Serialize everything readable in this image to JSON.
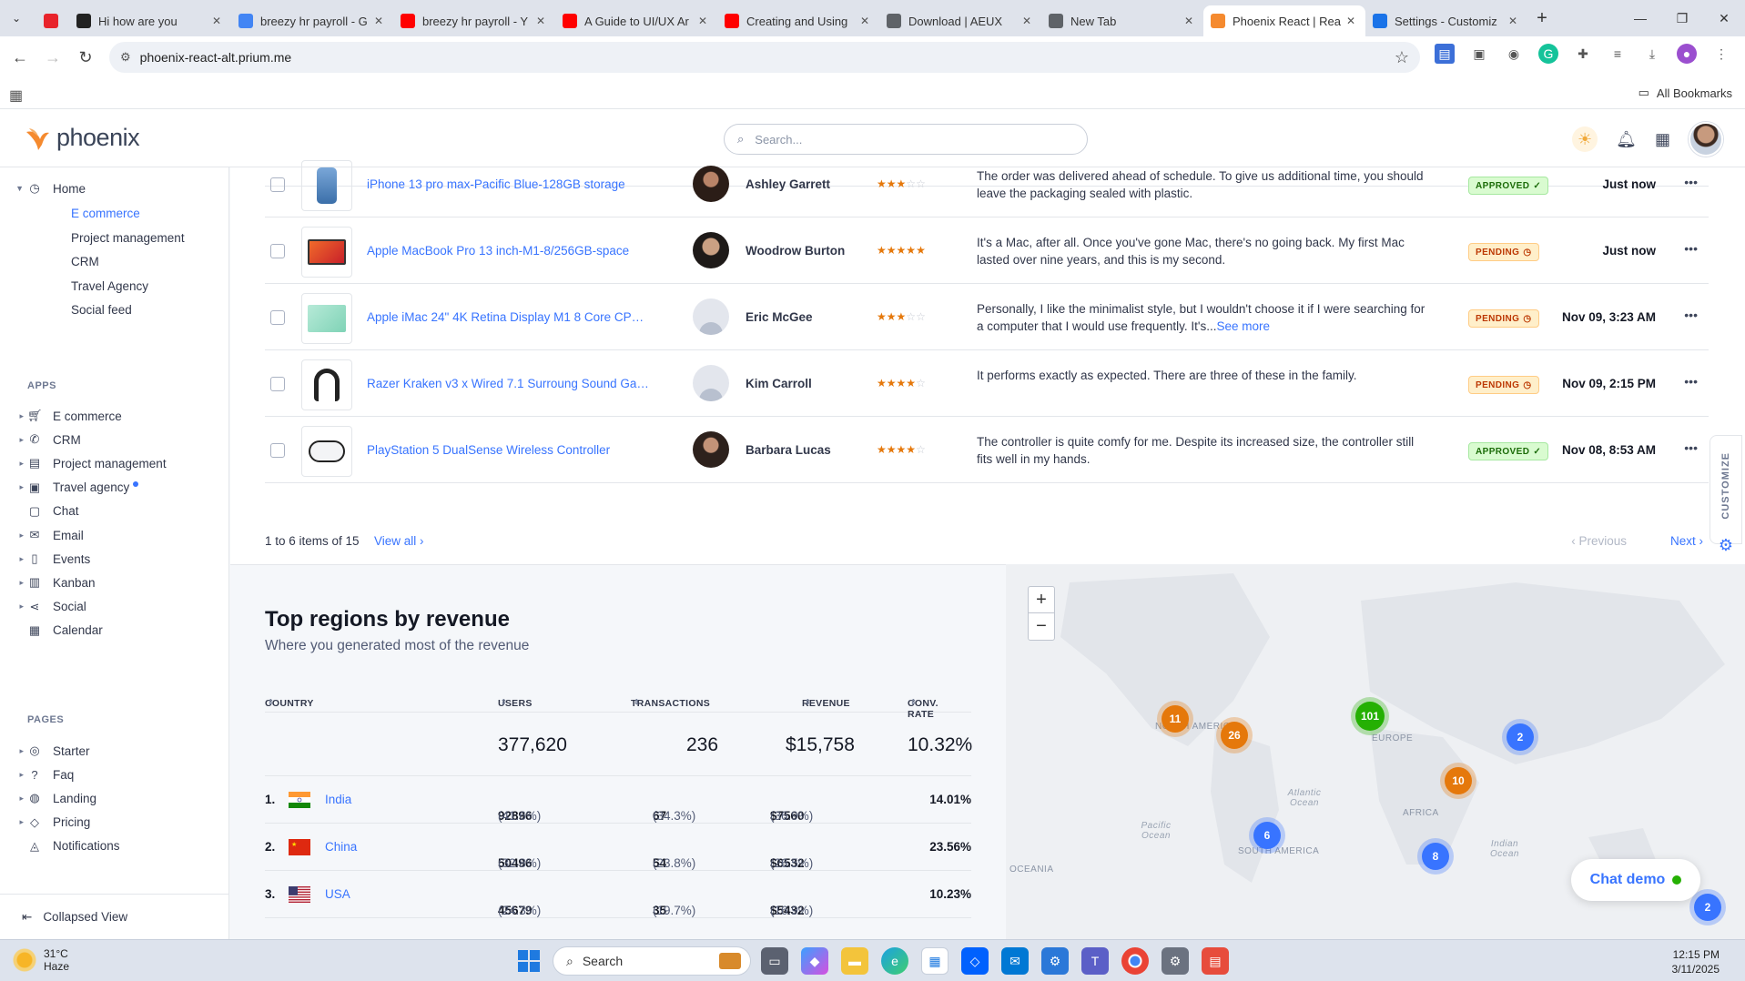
{
  "browser": {
    "tabs": [
      {
        "title": "",
        "color": "#e8232b",
        "pinned": true
      },
      {
        "title": "Hi how are you",
        "color": "#222222"
      },
      {
        "title": "breezy hr payroll - G",
        "color": "#4285f4"
      },
      {
        "title": "breezy hr payroll - Y",
        "color": "#ff0000"
      },
      {
        "title": "A Guide to UI/UX Ar",
        "color": "#ff0000"
      },
      {
        "title": "Creating and Using",
        "color": "#ff0000"
      },
      {
        "title": "Download | AEUX",
        "color": "#5f6368"
      },
      {
        "title": "New Tab",
        "color": "#5f6368"
      },
      {
        "title": "Phoenix React | Rea",
        "color": "#f58a2f",
        "active": true
      },
      {
        "title": "Settings - Customiz",
        "color": "#1a73e8"
      }
    ],
    "url": "phoenix-react-alt.prium.me",
    "all_bookmarks": "All Bookmarks"
  },
  "header": {
    "brand": "phoenix",
    "search_placeholder": "Search..."
  },
  "sidebar": {
    "home": "Home",
    "home_sub": [
      {
        "label": "E commerce",
        "active": true
      },
      {
        "label": "Project management"
      },
      {
        "label": "CRM"
      },
      {
        "label": "Travel Agency"
      },
      {
        "label": "Social feed"
      }
    ],
    "apps_heading": "APPS",
    "apps": [
      {
        "label": "E commerce",
        "icon": "cart-icon"
      },
      {
        "label": "CRM",
        "icon": "phone-icon"
      },
      {
        "label": "Project management",
        "icon": "clipboard-icon"
      },
      {
        "label": "Travel agency",
        "icon": "briefcase-icon"
      },
      {
        "label": "Chat",
        "icon": "chat-icon"
      },
      {
        "label": "Email",
        "icon": "mail-icon"
      },
      {
        "label": "Events",
        "icon": "bookmark-icon"
      },
      {
        "label": "Kanban",
        "icon": "kanban-icon"
      },
      {
        "label": "Social",
        "icon": "share-icon"
      },
      {
        "label": "Calendar",
        "icon": "calendar-icon"
      }
    ],
    "pages_heading": "PAGES",
    "pages": [
      {
        "label": "Starter",
        "icon": "compass-icon"
      },
      {
        "label": "Faq",
        "icon": "help-icon"
      },
      {
        "label": "Landing",
        "icon": "globe-icon"
      },
      {
        "label": "Pricing",
        "icon": "tag-icon"
      },
      {
        "label": "Notifications",
        "icon": "bell-icon"
      }
    ],
    "collapse": "Collapsed View"
  },
  "reviews": {
    "rows": [
      {
        "product": "iPhone 13 pro max-Pacific Blue-128GB storage",
        "reviewer": "Ashley Garrett",
        "rating": 3,
        "text": "The order was delivered ahead of schedule. To give us additional time, you should leave the packaging sealed with plastic.",
        "more": "",
        "status": "APPROVED",
        "time": "Just now"
      },
      {
        "product": "Apple MacBook Pro 13 inch-M1-8/256GB-space",
        "reviewer": "Woodrow Burton",
        "rating": 4.5,
        "text": "It's a Mac, after all. Once you've gone Mac, there's no going back. My first Mac lasted over nine years, and this is my second.",
        "more": "",
        "status": "PENDING",
        "time": "Just now"
      },
      {
        "product": "Apple iMac 24\" 4K Retina Display M1 8 Core CPU...",
        "reviewer": "Eric McGee",
        "rating": 3,
        "text": "Personally, I like the minimalist style, but I wouldn't choose it if I were searching for a computer that I would use frequently. It's...",
        "more": "See more",
        "status": "PENDING",
        "time": "Nov 09, 3:23 AM"
      },
      {
        "product": "Razer Kraken v3 x Wired 7.1 Surroung Sound Gam...",
        "reviewer": "Kim Carroll",
        "rating": 4,
        "text": "It performs exactly as expected. There are three of these in the family.",
        "more": "",
        "status": "PENDING",
        "time": "Nov 09, 2:15 PM"
      },
      {
        "product": "PlayStation 5 DualSense Wireless Controller",
        "reviewer": "Barbara Lucas",
        "rating": 4,
        "text": "The controller is quite comfy for me. Despite its increased size, the controller still fits well in my hands.",
        "more": "",
        "status": "APPROVED",
        "time": "Nov 08, 8:53 AM"
      }
    ],
    "footer_count": "1 to 6 items of 15",
    "view_all": "View all",
    "prev": "Previous",
    "next": "Next",
    "customize": "CUSTOMIZE"
  },
  "regions": {
    "title": "Top regions by revenue",
    "subtitle": "Where you generated most of the revenue",
    "columns": {
      "country": "COUNTRY",
      "users": "USERS",
      "transactions": "TRANSACTIONS",
      "revenue": "REVENUE",
      "conv": "CONV. RATE"
    },
    "totals": {
      "users": "377,620",
      "transactions": "236",
      "revenue": "$15,758",
      "conv": "10.32%"
    },
    "rows": [
      {
        "rank": "1.",
        "country": "India",
        "users": "92896",
        "users_pct": "(41.6%)",
        "trans": "67",
        "trans_pct": "(34.3%)",
        "rev": "$7560",
        "rev_pct": "(36.9%)",
        "conv": "14.01%"
      },
      {
        "rank": "2.",
        "country": "China",
        "users": "50496",
        "users_pct": "(32.8%)",
        "trans": "54",
        "trans_pct": "(23.8%)",
        "rev": "$6532",
        "rev_pct": "(26.5%)",
        "conv": "23.56%"
      },
      {
        "rank": "3.",
        "country": "USA",
        "users": "45679",
        "users_pct": "(24.3%)",
        "trans": "35",
        "trans_pct": "(19.7%)",
        "rev": "$5432",
        "rev_pct": "(16.9%)",
        "conv": "10.23%"
      }
    ]
  },
  "map": {
    "clusters": [
      "11",
      "26",
      "101",
      "2",
      "10",
      "6",
      "8",
      "2"
    ],
    "labels": {
      "north_america": "NORTH AMERICA",
      "europe": "EUROPE",
      "africa": "AFRICA",
      "south_america": "SOUTH AMERICA",
      "oceania": "OCEANIA",
      "atlantic": "Atlantic Ocean",
      "pacific": "Pacific Ocean",
      "indian": "Indian Ocean"
    }
  },
  "chat_demo": "Chat demo",
  "taskbar": {
    "temp": "31°C",
    "condition": "Haze",
    "search": "Search",
    "time": "12:15 PM",
    "date": "3/11/2025"
  }
}
